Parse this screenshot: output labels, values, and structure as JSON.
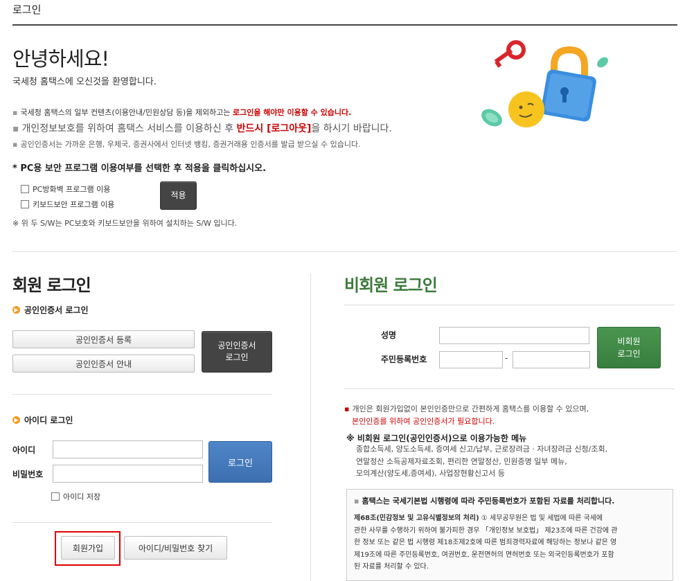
{
  "header": {
    "title": "로그인"
  },
  "greeting": {
    "title": "안녕하세요!",
    "welcome": "국세청 홈택스에 오신것을 환영합니다."
  },
  "notices": {
    "n1_pre": "국세청 홈택스의 일부 컨텐츠(이용안내/민원상담 등)을 제외하고는 ",
    "n1_red": "로그인을 해야만 이용할 수 있습니다.",
    "n2_pre": "개인정보보호를 위하여 홈택스 서비스를 이용하신 후 ",
    "n2_red": "반드시 [로그아웃]",
    "n2_post": "을 하시기 바랍니다.",
    "n3": "공인인증서는 가까운 은행, 우체국, 증권사에서 인터넷 뱅킹, 증권거래용 인증서를 발급 받으실 수 있습니다."
  },
  "security_program": {
    "heading": "* PC용 보안 프로그램 이용여부를 선택한 후 적용을 클릭하십시오.",
    "firewall_label": "PC방화벽 프로그램 이용",
    "keyboard_label": "키보드보안 프로그램 이용",
    "apply_label": "적용",
    "note": "※ 위 두 S/W는 PC보호와 키보드보안을 위하여 설치하는 S/W 입니다."
  },
  "member_login": {
    "title": "회원 로그인",
    "cert_section": "공인인증서 로그인",
    "cert_register": "공인인증서 등록",
    "cert_guide": "공인인증서 안내",
    "cert_login_line1": "공인인증서",
    "cert_login_line2": "로그인",
    "id_section": "아이디 로그인",
    "id_label": "아이디",
    "pw_label": "비밀번호",
    "id_value": "",
    "pw_value": "",
    "login_label": "로그인",
    "save_id_label": "아이디 저장",
    "join_label": "회원가입",
    "find_label": "아이디/비밀번호 찾기"
  },
  "nonmember_login": {
    "title": "비회원 로그인",
    "name_label": "성명",
    "rrn_label": "주민등록번호",
    "name_value": "",
    "rrn_front": "",
    "rrn_back": "",
    "rrn_dash": "-",
    "login_line1": "비회원",
    "login_line2": "로그인",
    "info1": "개인은 회원가입없이 본인인증만으로 간편하게 홈택스를 이용할 수 있으며,",
    "info2": "본인인증를 위하여 공인인증서가 필요합니다.",
    "menu_heading": "※ 비회원 로그인(공인인증서)으로 이용가능한 메뉴",
    "menu1": "종합소득세, 양도소득세, 증여세 신고/납부, 근로장려금 · 자녀장려금 신청/조회,",
    "menu2": "연말정산 소득공제자료조회, 편리한 연말정산, 민원증명 일부 메뉴,",
    "menu3": "모의계산(양도세,증여세), 사업장현황신고서 등",
    "box_heading": "홈택스는 국세기본법 시행령에 따라 주민등록번호가 포함된 자료를 처리합니다.",
    "box_law_bold": "제68조(민감정보 및 고유식별정보의 처리)",
    "box_law1": " ① 세무공무원은 법 및 세법에 따른 국세에",
    "box_law2": "관한 사무를 수행하기 위하여 불가피한 경우 「개인정보 보호법」 제23조에 따른 건강에 관",
    "box_law3": "한 정보 또는 같은 법 시행령 제18조제2호에 따른 범죄경력자료에 해당하는 정보나 같은 영",
    "box_law4": "제19조에 따른 주민등록번호, 여권번호, 운전면허의 면허번호 또는 외국인등록번호가 포함",
    "box_law5": "된 자료를 처리할 수 있다."
  },
  "colors": {
    "accent_red": "#c00000",
    "member_blue": "#3c6fb0",
    "nonmember_green": "#387d3e",
    "highlight_red_border": "#e00000"
  }
}
